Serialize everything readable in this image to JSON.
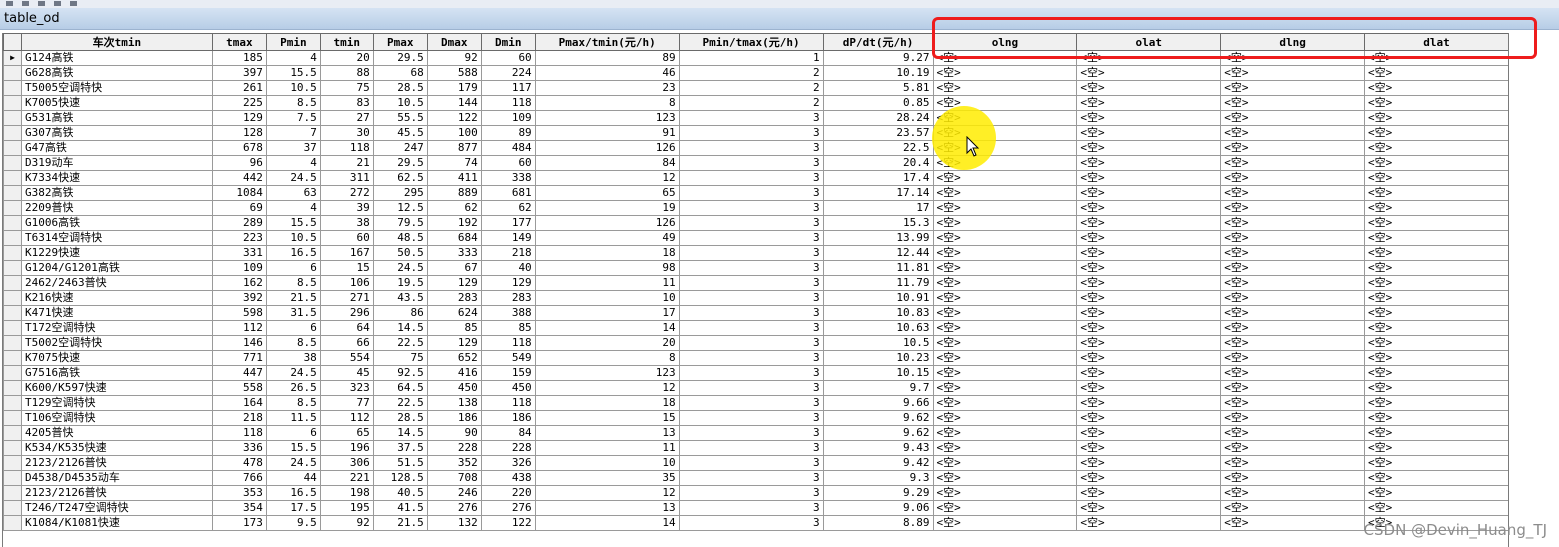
{
  "window": {
    "title": "table_od"
  },
  "table": {
    "columns": [
      "车次tmin",
      "tmax",
      "Pmin",
      "tmin",
      "Pmax",
      "Dmax",
      "Dmin",
      "Pmax/tmin(元/h)",
      "Pmin/tmax(元/h)",
      "dP/dt(元/h)",
      "olng",
      "olat",
      "dlng",
      "dlat"
    ],
    "null_text": "<空>",
    "current_row_marker": "▶",
    "rows": [
      [
        "G124高铁",
        "185",
        "4",
        "20",
        "29.5",
        "92",
        "60",
        "89",
        "1",
        "9.27"
      ],
      [
        "G628高铁",
        "397",
        "15.5",
        "88",
        "68",
        "588",
        "224",
        "46",
        "2",
        "10.19"
      ],
      [
        "T5005空调特快",
        "261",
        "10.5",
        "75",
        "28.5",
        "179",
        "117",
        "23",
        "2",
        "5.81"
      ],
      [
        "K7005快速",
        "225",
        "8.5",
        "83",
        "10.5",
        "144",
        "118",
        "8",
        "2",
        "0.85"
      ],
      [
        "G531高铁",
        "129",
        "7.5",
        "27",
        "55.5",
        "122",
        "109",
        "123",
        "3",
        "28.24"
      ],
      [
        "G307高铁",
        "128",
        "7",
        "30",
        "45.5",
        "100",
        "89",
        "91",
        "3",
        "23.57"
      ],
      [
        "G47高铁",
        "678",
        "37",
        "118",
        "247",
        "877",
        "484",
        "126",
        "3",
        "22.5"
      ],
      [
        "D319动车",
        "96",
        "4",
        "21",
        "29.5",
        "74",
        "60",
        "84",
        "3",
        "20.4"
      ],
      [
        "K7334快速",
        "442",
        "24.5",
        "311",
        "62.5",
        "411",
        "338",
        "12",
        "3",
        "17.4"
      ],
      [
        "G382高铁",
        "1084",
        "63",
        "272",
        "295",
        "889",
        "681",
        "65",
        "3",
        "17.14"
      ],
      [
        "2209普快",
        "69",
        "4",
        "39",
        "12.5",
        "62",
        "62",
        "19",
        "3",
        "17"
      ],
      [
        "G1006高铁",
        "289",
        "15.5",
        "38",
        "79.5",
        "192",
        "177",
        "126",
        "3",
        "15.3"
      ],
      [
        "T6314空调特快",
        "223",
        "10.5",
        "60",
        "48.5",
        "684",
        "149",
        "49",
        "3",
        "13.99"
      ],
      [
        "K1229快速",
        "331",
        "16.5",
        "167",
        "50.5",
        "333",
        "218",
        "18",
        "3",
        "12.44"
      ],
      [
        "G1204/G1201高铁",
        "109",
        "6",
        "15",
        "24.5",
        "67",
        "40",
        "98",
        "3",
        "11.81"
      ],
      [
        "2462/2463普快",
        "162",
        "8.5",
        "106",
        "19.5",
        "129",
        "129",
        "11",
        "3",
        "11.79"
      ],
      [
        "K216快速",
        "392",
        "21.5",
        "271",
        "43.5",
        "283",
        "283",
        "10",
        "3",
        "10.91"
      ],
      [
        "K471快速",
        "598",
        "31.5",
        "296",
        "86",
        "624",
        "388",
        "17",
        "3",
        "10.83"
      ],
      [
        "T172空调特快",
        "112",
        "6",
        "64",
        "14.5",
        "85",
        "85",
        "14",
        "3",
        "10.63"
      ],
      [
        "T5002空调特快",
        "146",
        "8.5",
        "66",
        "22.5",
        "129",
        "118",
        "20",
        "3",
        "10.5"
      ],
      [
        "K7075快速",
        "771",
        "38",
        "554",
        "75",
        "652",
        "549",
        "8",
        "3",
        "10.23"
      ],
      [
        "G7516高铁",
        "447",
        "24.5",
        "45",
        "92.5",
        "416",
        "159",
        "123",
        "3",
        "10.15"
      ],
      [
        "K600/K597快速",
        "558",
        "26.5",
        "323",
        "64.5",
        "450",
        "450",
        "12",
        "3",
        "9.7"
      ],
      [
        "T129空调特快",
        "164",
        "8.5",
        "77",
        "22.5",
        "138",
        "118",
        "18",
        "3",
        "9.66"
      ],
      [
        "T106空调特快",
        "218",
        "11.5",
        "112",
        "28.5",
        "186",
        "186",
        "15",
        "3",
        "9.62"
      ],
      [
        "4205普快",
        "118",
        "6",
        "65",
        "14.5",
        "90",
        "84",
        "13",
        "3",
        "9.62"
      ],
      [
        "K534/K535快速",
        "336",
        "15.5",
        "196",
        "37.5",
        "228",
        "228",
        "11",
        "3",
        "9.43"
      ],
      [
        "2123/2126普快",
        "478",
        "24.5",
        "306",
        "51.5",
        "352",
        "326",
        "10",
        "3",
        "9.42"
      ],
      [
        "D4538/D4535动车",
        "766",
        "44",
        "221",
        "128.5",
        "708",
        "438",
        "35",
        "3",
        "9.3"
      ],
      [
        "2123/2126普快",
        "353",
        "16.5",
        "198",
        "40.5",
        "246",
        "220",
        "12",
        "3",
        "9.29"
      ],
      [
        "T246/T247空调特快",
        "354",
        "17.5",
        "195",
        "41.5",
        "276",
        "276",
        "13",
        "3",
        "9.06"
      ],
      [
        "K1084/K1081快速",
        "173",
        "9.5",
        "92",
        "21.5",
        "132",
        "122",
        "14",
        "3",
        "8.89"
      ]
    ]
  },
  "watermark": "CSDN @Devin_Huang_TJ"
}
